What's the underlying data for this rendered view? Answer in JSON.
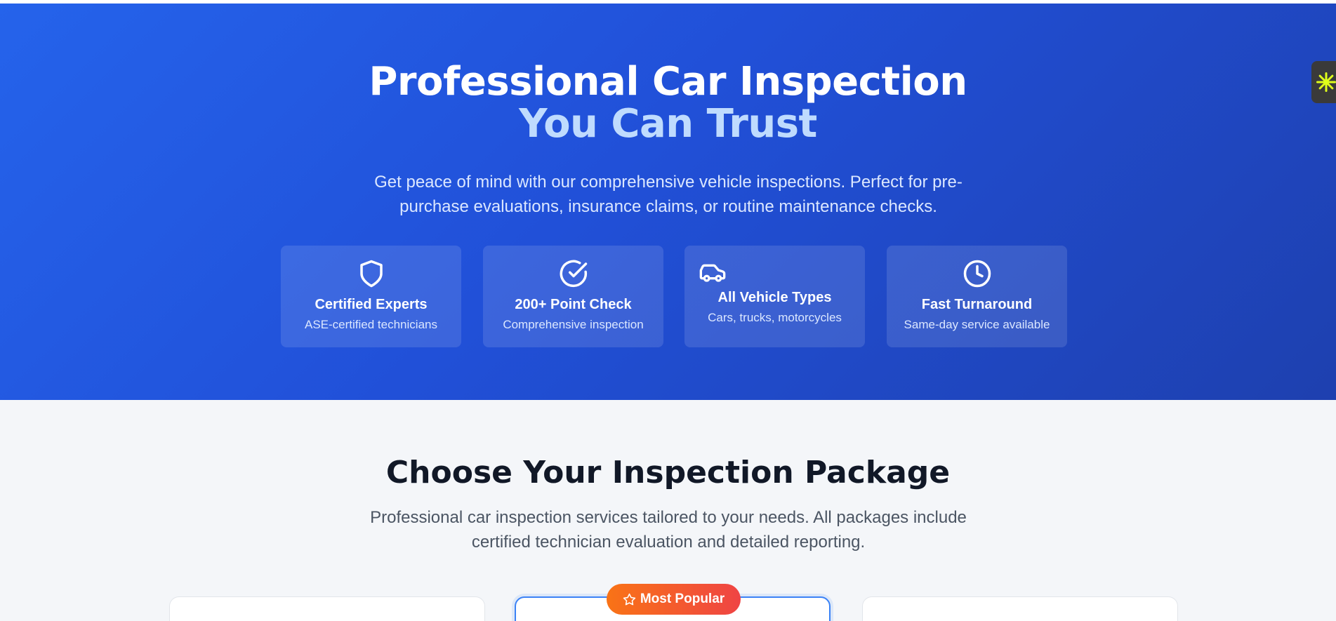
{
  "hero": {
    "title": "Professional Car Inspection",
    "title_accent": "You Can Trust",
    "subtitle": "Get peace of mind with our comprehensive vehicle inspections. Perfect for pre-purchase evaluations, insurance claims, or routine maintenance checks."
  },
  "features": [
    {
      "icon": "shield-icon",
      "title": "Certified Experts",
      "subtitle": "ASE-certified technicians"
    },
    {
      "icon": "check-circle-icon",
      "title": "200+ Point Check",
      "subtitle": "Comprehensive inspection"
    },
    {
      "icon": "car-icon",
      "title": "All Vehicle Types",
      "subtitle": "Cars, trucks, motorcycles"
    },
    {
      "icon": "clock-icon",
      "title": "Fast Turnaround",
      "subtitle": "Same-day service available"
    }
  ],
  "packages_section": {
    "title": "Choose Your Inspection Package",
    "subtitle": "Professional car inspection services tailored to your needs. All packages include certified technician evaluation and detailed reporting.",
    "popular_badge": "Most Popular"
  },
  "colors": {
    "hero_gradient_start": "#2563eb",
    "hero_gradient_end": "#1e40af",
    "accent_text": "#bfdbfe",
    "badge_start": "#f97316",
    "badge_end": "#ef4444",
    "widget_icon": "#e0ff1a"
  },
  "widget": {
    "icon": "asterisk-burst-icon"
  }
}
